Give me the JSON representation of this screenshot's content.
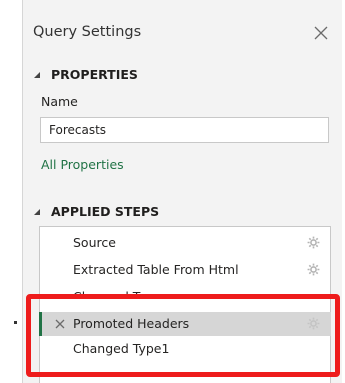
{
  "pane": {
    "title": "Query Settings",
    "close_icon": "close-icon"
  },
  "properties": {
    "heading": "PROPERTIES",
    "name_label": "Name",
    "name_value": "Forecasts",
    "all_properties_link": "All Properties"
  },
  "applied_steps": {
    "heading": "APPLIED STEPS",
    "steps": [
      {
        "label": "Source",
        "has_settings": true,
        "icon": "gear-icon"
      },
      {
        "label": "Extracted Table From Html",
        "has_settings": true,
        "icon": "gear-icon"
      },
      {
        "label": "Changed Type",
        "has_settings": false
      },
      {
        "label": "Promoted Headers",
        "has_settings": true,
        "selected": true,
        "icon": "gear-icon",
        "delete_icon": "close-icon"
      },
      {
        "label": "Changed Type1",
        "has_settings": false
      }
    ]
  },
  "colors": {
    "pane_background": "#f3f3f3",
    "link": "#217346",
    "selection_background": "#d6d6d6",
    "annotation_outline": "#ee1c1c"
  }
}
